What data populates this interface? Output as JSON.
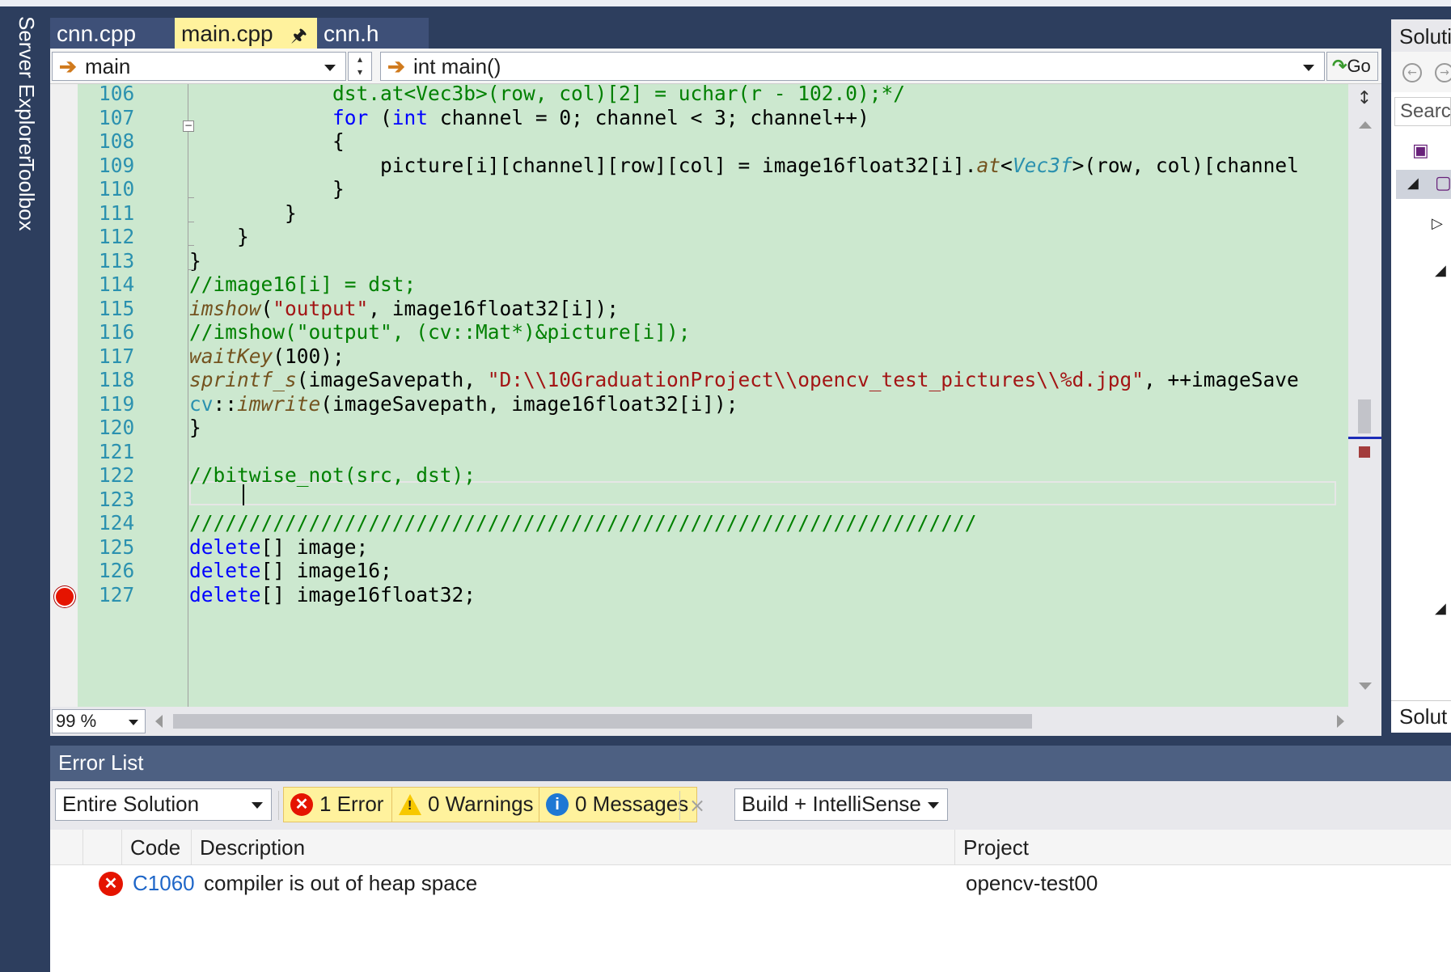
{
  "left_toolbar": {
    "server_explorer": "Server Explorer",
    "toolbox": "Toolbox"
  },
  "tabs": [
    {
      "label": "cnn.cpp",
      "active": false
    },
    {
      "label": "main.cpp",
      "active": true,
      "pin_icon": "pin-icon",
      "close_icon": "close-icon"
    },
    {
      "label": "cnn.h",
      "active": false
    }
  ],
  "navigation": {
    "scope": "main",
    "member": "int main()",
    "go_label": "Go"
  },
  "editor": {
    "lines": [
      {
        "num": "106",
        "html": "            dst.at&lt;Vec3b&gt;(row, col)[2] = uchar(r - 102.0);*/",
        "style": "cm"
      },
      {
        "num": "107",
        "html": "            <span class=\"kw\">for</span> (<span class=\"kw\">int</span> channel = 0; channel &lt; 3; channel++)"
      },
      {
        "num": "108",
        "html": "            {"
      },
      {
        "num": "109",
        "html": "                picture[i][channel][row][col] = image16float32[i].<span class=\"fn\">at</span>&lt;<span class=\"ty\">Vec3f</span>&gt;(row, col)[channel"
      },
      {
        "num": "110",
        "html": "            }"
      },
      {
        "num": "111",
        "html": "        }"
      },
      {
        "num": "112",
        "html": "    }"
      },
      {
        "num": "113",
        "html": "}"
      },
      {
        "num": "114",
        "html": "<span class=\"cm\">//image16[i] = dst;</span>"
      },
      {
        "num": "115",
        "html": "<span class=\"fn\">imshow</span>(<span class=\"st\">\"output\"</span>, image16float32[i]);"
      },
      {
        "num": "116",
        "html": "<span class=\"cm\">//imshow(\"output\", (cv::Mat*)&amp;picture[i]);</span>"
      },
      {
        "num": "117",
        "html": "<span class=\"fn\">waitKey</span>(100);"
      },
      {
        "num": "118",
        "html": "<span class=\"fn\">sprintf_s</span>(imageSavepath, <span class=\"st\">\"D:\\\\10GraduationProject\\\\opencv_test_pictures\\\\%d.jpg\"</span>, ++imageSave"
      },
      {
        "num": "119",
        "html": "<span class=\"ns\">cv</span>::<span class=\"fn\">imwrite</span>(imageSavepath, image16float32[i]);"
      },
      {
        "num": "120",
        "html": "}"
      },
      {
        "num": "121",
        "html": ""
      },
      {
        "num": "122",
        "html": "<span class=\"cm\">//bitwise_not(src, dst);</span>"
      },
      {
        "num": "123",
        "html": ""
      },
      {
        "num": "124",
        "html": "<span class=\"cm\">//////////////////////////////////////////////////////////////////</span>"
      },
      {
        "num": "125",
        "html": "<span class=\"kw\">delete</span>[] image;"
      },
      {
        "num": "126",
        "html": "<span class=\"kw\">delete</span>[] image16;"
      },
      {
        "num": "127",
        "html": "<span class=\"kw\">delete</span>[] image16float32;"
      }
    ],
    "zoom": "99 %",
    "breakpoint_line": "125",
    "current_line": "121"
  },
  "solution_explorer": {
    "title": "Soluti",
    "search_placeholder": "Searc",
    "footer": "Solut"
  },
  "error_list": {
    "title": "Error List",
    "scope": "Entire Solution",
    "errors_label": "1 Error",
    "warnings_label": "0 Warnings",
    "messages_label": "0 Messages",
    "build_filter": "Build + IntelliSense",
    "columns": {
      "code": "Code",
      "description": "Description",
      "project": "Project"
    },
    "rows": [
      {
        "code": "C1060",
        "description": "compiler is out of heap space",
        "project": "opencv-test00"
      }
    ]
  },
  "colors": {
    "editor_background": "#cce8cf",
    "active_tab": "#fff29d",
    "chrome_dark": "#2d3e5e",
    "keyword": "#0000ff",
    "comment": "#008000",
    "string": "#a31515",
    "line_number": "#2b91af",
    "error_red": "#e51400"
  }
}
